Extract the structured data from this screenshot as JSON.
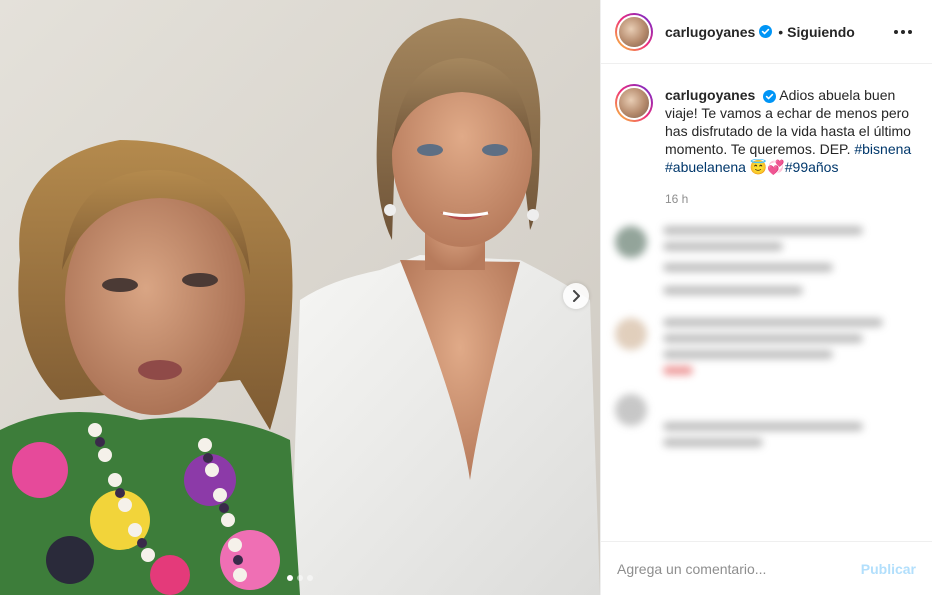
{
  "post": {
    "username": "carlugoyanes",
    "follow_separator": "•",
    "follow_status": "Siguiendo",
    "verified_icon": "verified-badge-icon",
    "more_icon": "more-options-icon",
    "brand_blue": "#0095f6"
  },
  "caption": {
    "username": "carlugoyanes",
    "text": "Adios abuela buen viaje! Te vamos a echar de menos pero has disfrutado de la vida hasta el último momento. Te queremos. DEP.",
    "hashtags": [
      "#bisnena",
      "#abuelanena"
    ],
    "emojis": "😇💞",
    "hashtag_last": "#99años",
    "time": "16 h"
  },
  "carousel": {
    "next_icon": "chevron-right-icon",
    "dots": 3,
    "active_dot": 1
  },
  "footer": {
    "placeholder": "Agrega un comentario...",
    "publish_label": "Publicar"
  }
}
